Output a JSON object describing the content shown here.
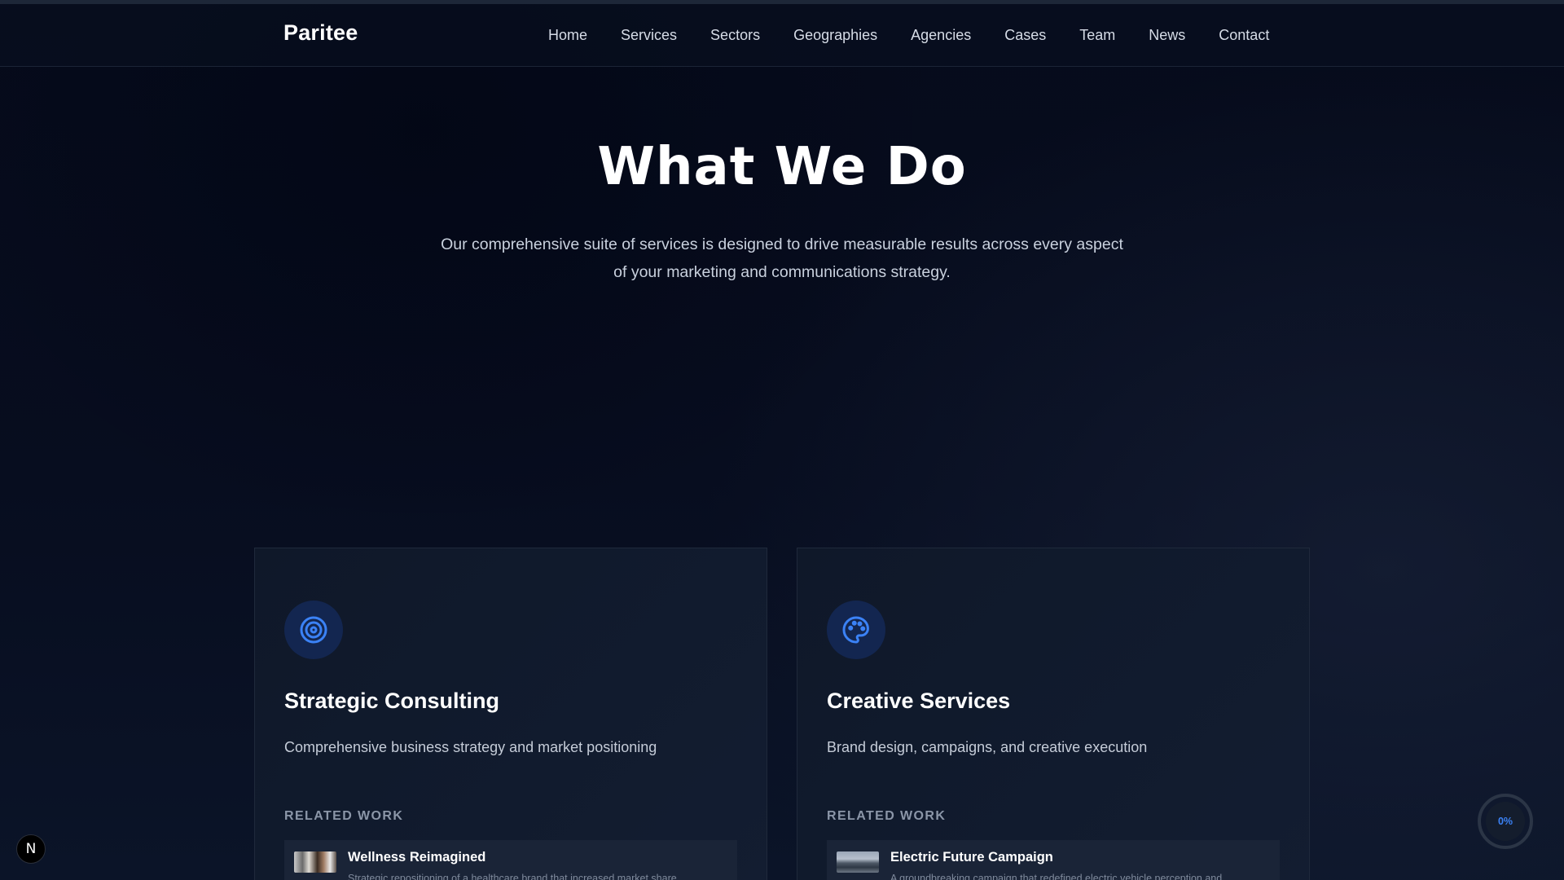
{
  "brand": "Paritee",
  "nav": [
    "Home",
    "Services",
    "Sectors",
    "Geographies",
    "Agencies",
    "Cases",
    "Team",
    "News",
    "Contact"
  ],
  "hero": {
    "title": "What We Do",
    "subtitle_line1": "Our comprehensive suite of services is designed to drive measurable results across every aspect",
    "subtitle_line2": "of your marketing and communications strategy."
  },
  "cards": [
    {
      "icon": "target-icon",
      "title": "Strategic Consulting",
      "description": "Comprehensive business strategy and market positioning",
      "related_label": "RELATED WORK",
      "related_title": "Wellness Reimagined",
      "related_desc": "Strategic repositioning of a healthcare brand that increased market share"
    },
    {
      "icon": "palette-icon",
      "title": "Creative Services",
      "description": "Brand design, campaigns, and creative execution",
      "related_label": "RELATED WORK",
      "related_title": "Electric Future Campaign",
      "related_desc": "A groundbreaking campaign that redefined electric vehicle perception and"
    }
  ],
  "floating": {
    "badge_letter": "N",
    "scroll_progress": "0%"
  },
  "colors": {
    "accent": "#3b82f6",
    "icon_bg": "#132650",
    "background": "#060b1b"
  }
}
